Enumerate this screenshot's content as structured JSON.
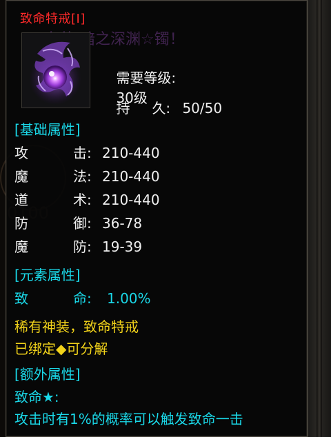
{
  "title": "致命特戒[I]",
  "background_name": "有的 暗之深渊☆镯！",
  "requirement": {
    "label": "需要等级:",
    "value": "30级"
  },
  "durability": {
    "label1": "持",
    "label2": "久:",
    "value": "50/50"
  },
  "base_section": "[基础属性]",
  "base_stats": [
    {
      "k1": "攻",
      "k2": "击:",
      "value": "210-440"
    },
    {
      "k1": "魔",
      "k2": "法:",
      "value": "210-440"
    },
    {
      "k1": "道",
      "k2": "术:",
      "value": "210-440"
    },
    {
      "k1": "防",
      "k2": "御:",
      "value": "36-78"
    },
    {
      "k1": "魔",
      "k2": "防:",
      "value": "19-39"
    }
  ],
  "element_section": "[元素属性]",
  "element_stats": [
    {
      "k1": "致",
      "k2": "命:",
      "value": "1.00%"
    }
  ],
  "rarity_line": "稀有神装，致命特戒",
  "binding_line": "已绑定◆可分解",
  "extra_section": "[额外属性]",
  "extra_title": "致命★:",
  "extra_desc": "攻击时有1%的概率可以触发致命一击",
  "colors": {
    "title": "#ff2a2a",
    "section": "#1ad8e8",
    "rarity": "#f1d21a",
    "text": "#efefef"
  }
}
